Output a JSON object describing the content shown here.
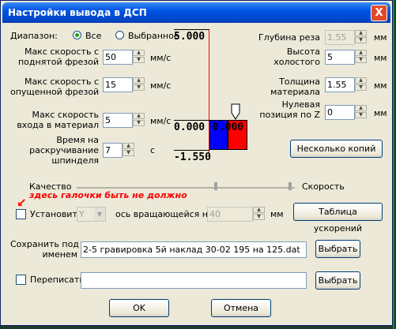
{
  "window": {
    "title": "Настройки вывода в ДСП",
    "close_glyph": "X"
  },
  "range": {
    "label": "Диапазон:",
    "all": "Все",
    "selected": "Выбранное"
  },
  "left": {
    "max_speed_up_label1": "Макс скорость с",
    "max_speed_up_label2": "поднятой фрезой",
    "max_speed_up_value": "50",
    "max_speed_down_label1": "Макс скорость с",
    "max_speed_down_label2": "опущенной фрезой",
    "max_speed_down_value": "15",
    "max_speed_in_label1": "Макс скорость",
    "max_speed_in_label2": "входа в материал",
    "max_speed_in_value": "5",
    "spinup_label1": "Время на",
    "spinup_label2": "раскручивание",
    "spinup_label3": "шпинделя",
    "spinup_value": "7",
    "unit_mms": "мм/с",
    "unit_s": "с"
  },
  "diagram": {
    "top_value": "5.000",
    "mid_value": "0.000",
    "block_value": "0.000",
    "bottom_value": "-1.550",
    "colors": {
      "blue": "#0000ff",
      "red": "#ff0000",
      "axis": "#ff0000"
    }
  },
  "right": {
    "cut_depth_label": "Глубина реза",
    "cut_depth_value": "1.55",
    "idle_height_label1": "Высота",
    "idle_height_label2": "холостого",
    "idle_height_value": "5",
    "thickness_label1": "Толщина",
    "thickness_label2": "материала",
    "thickness_value": "1.55",
    "zero_label1": "Нулевая",
    "zero_label2": "позиция по Z",
    "zero_value": "0",
    "unit_mm": "мм",
    "copies_button": "Несколько копий"
  },
  "quality": {
    "left_label": "Качество",
    "right_label": "Скорость"
  },
  "annotation": {
    "text": "здесь галочки быть не должно",
    "arrow": "↙"
  },
  "install": {
    "label": "Установить",
    "axis_value": "Y",
    "axis_label": "ось вращающейся на",
    "value": "40",
    "unit": "мм",
    "table_button": "Таблица ускорений"
  },
  "save": {
    "label1": "Сохранить под",
    "label2": "именем",
    "filename": "2-5 гравировка 5й наклад 30-02 195 на 125.dat",
    "choose_button": "Выбрать"
  },
  "rewrite": {
    "label": "Переписать",
    "value": "",
    "choose_button": "Выбрать"
  },
  "footer": {
    "ok": "OK",
    "cancel": "Отмена"
  }
}
